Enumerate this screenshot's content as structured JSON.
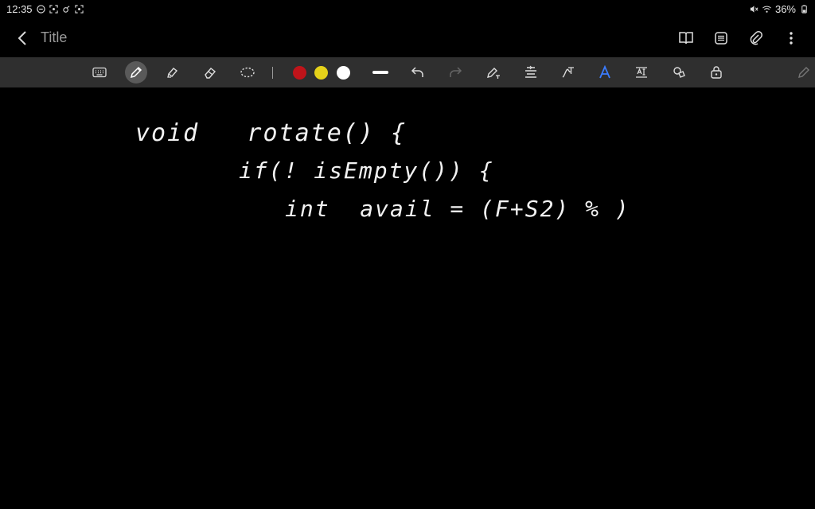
{
  "status_bar": {
    "time": "12:35",
    "battery": "36%",
    "left_icons": [
      "do-not-disturb-icon",
      "screenshot-icon",
      "cast-icon",
      "screenshot-icon"
    ],
    "right_icons": [
      "mute-icon",
      "wifi-icon",
      "battery-icon"
    ]
  },
  "header": {
    "title": "Title",
    "actions": [
      "book-view-icon",
      "page-list-icon",
      "attachment-icon",
      "more-options-icon"
    ]
  },
  "toolbar": {
    "tools": [
      "keyboard-icon",
      "pen-icon",
      "highlighter-icon",
      "eraser-icon",
      "lasso-icon"
    ],
    "active_tool": "pen-icon",
    "colors": [
      "#c0141a",
      "#e5d21a",
      "#ffffff"
    ],
    "after_colors": [
      "stroke-width-icon",
      "undo-icon",
      "redo-icon",
      "pen-to-text-icon",
      "text-align-icon",
      "handwriting-text-icon",
      "text-style-icon",
      "text-box-icon",
      "shapes-icon",
      "lock-icon",
      "edit-icon"
    ]
  },
  "note": {
    "lines": [
      "void   rotate() {",
      "if(! isEmpty()) {",
      "int  avail = (F+S2) % )"
    ]
  }
}
